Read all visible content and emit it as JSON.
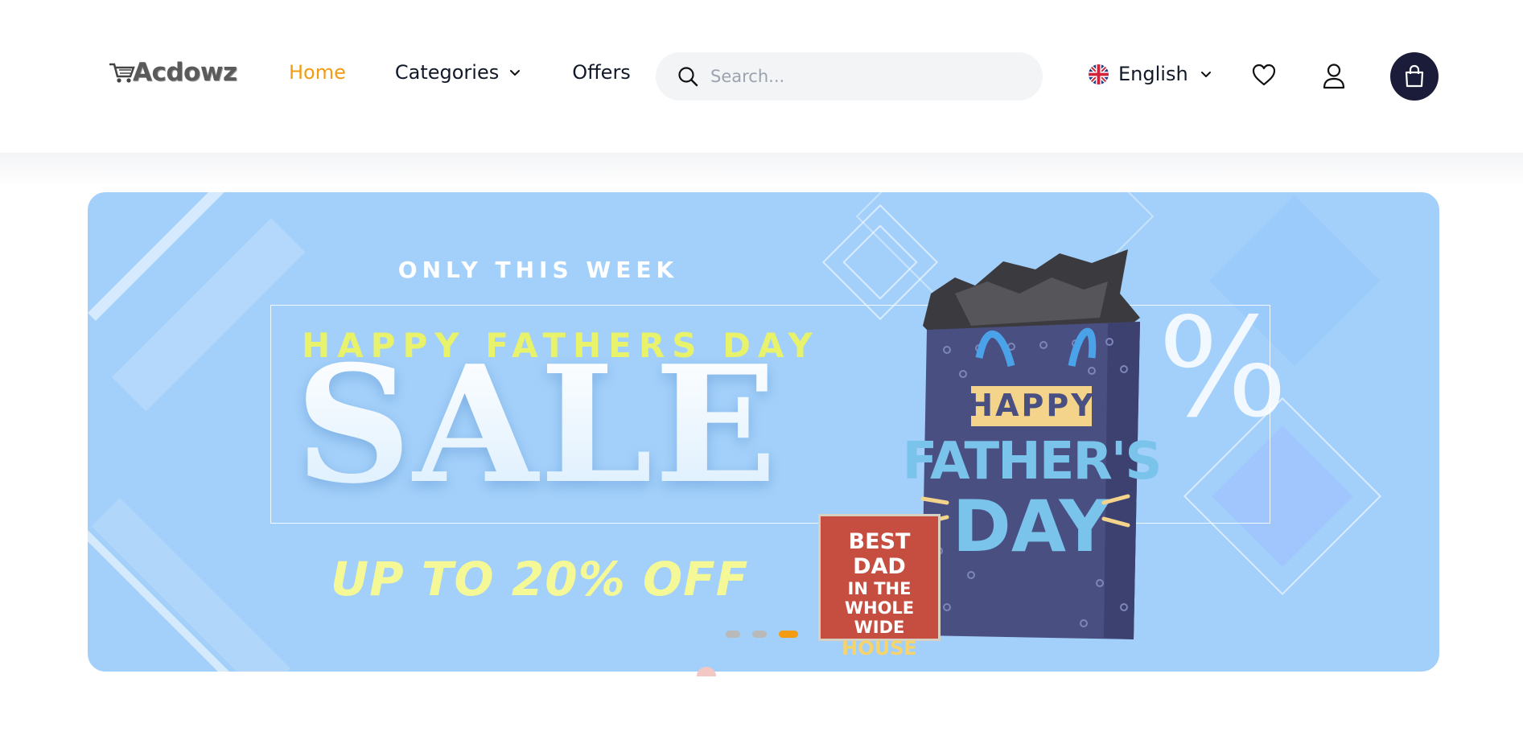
{
  "header": {
    "logo_text": "Acdowz",
    "nav": {
      "home": "Home",
      "categories": "Categories",
      "offers": "Offers"
    },
    "search": {
      "placeholder": "Search..."
    },
    "language": {
      "label": "English",
      "icon": "uk-flag-icon"
    },
    "icons": {
      "wishlist": "heart-icon",
      "account": "user-icon",
      "cart": "shopping-bag-icon"
    }
  },
  "banner": {
    "eyebrow": "ONLY THIS WEEK",
    "headline": "HAPPY FATHERS DAY",
    "big_text": "SALE",
    "discount": "UP TO 20% OFF",
    "percent_symbol": "%",
    "bag_text": [
      "HAPPY",
      "FATHER'S",
      "DAY"
    ],
    "card_text": [
      "BEST DAD",
      "IN THE",
      "WHOLE WIDE",
      "HOUSE"
    ],
    "slides_total": 3,
    "active_slide": 3
  },
  "colors": {
    "accent": "#f39c12",
    "banner_bg": "#a3d0fa",
    "cart_button": "#1b1b3a",
    "headline": "#e8f26a",
    "discount": "#f4f896"
  }
}
